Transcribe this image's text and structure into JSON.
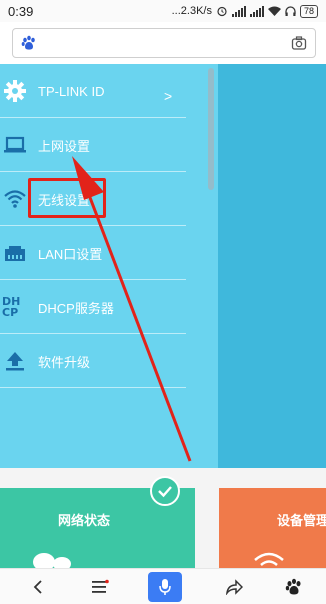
{
  "status_bar": {
    "time": "0:39",
    "net_speed": "...2.3K/s",
    "battery": "78"
  },
  "address_bar": {
    "icons": [
      "baidu-paw-icon",
      "camera-icon"
    ]
  },
  "router_menu": {
    "items": [
      {
        "label": "TP-LINK ID",
        "icon": "gear-icon",
        "chevron": ">"
      },
      {
        "label": "上网设置",
        "icon": "laptop-icon"
      },
      {
        "label": "无线设置",
        "icon": "wifi-icon"
      },
      {
        "label": "LAN口设置",
        "icon": "lan-port-icon"
      },
      {
        "label": "DHCP服务器",
        "icon": "dhcp-icon",
        "icon_text": "DH\nCP"
      },
      {
        "label": "软件升级",
        "icon": "upload-icon"
      }
    ]
  },
  "cards": {
    "network_status": "网络状态",
    "device_management": "设备管理"
  },
  "colors": {
    "menu_bg": "#6ad4ef",
    "right_panel": "#3fb8dc",
    "highlight": "#e2231a",
    "card_green": "#3cc6a4",
    "card_orange": "#f07a4a",
    "mic_blue": "#3b7cf4"
  },
  "bottom_nav": {
    "icons": [
      "back-icon",
      "menu-icon",
      "mic-icon",
      "share-icon",
      "baidu-paw-icon"
    ]
  }
}
